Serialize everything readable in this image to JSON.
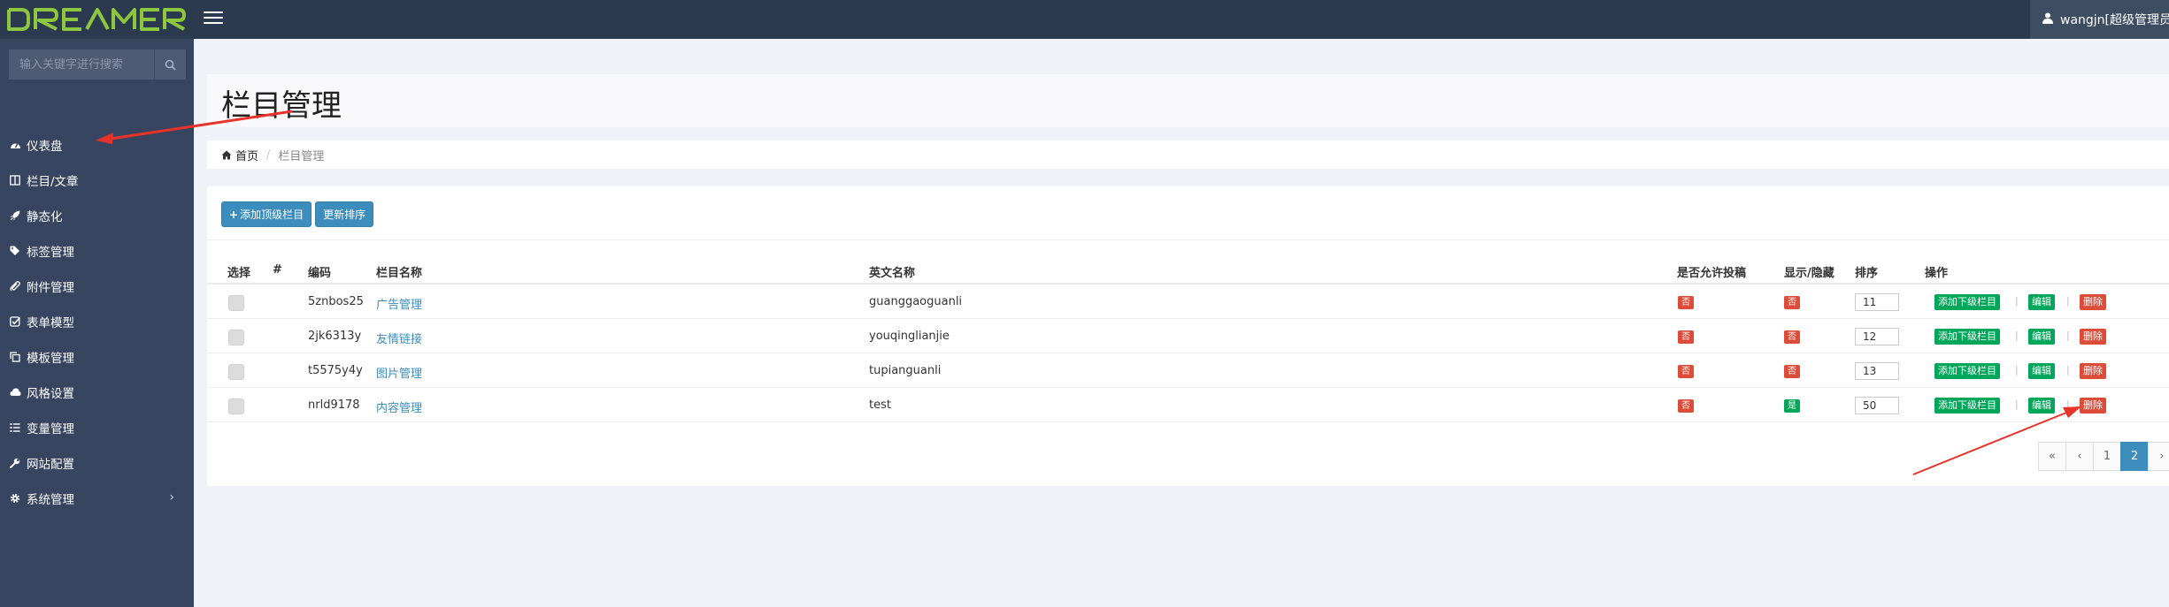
{
  "header": {
    "logo_text": "DREAMER",
    "user_label": "wangjn[超级管理员"
  },
  "sidebar": {
    "search_placeholder": "输入关键字进行搜索",
    "items": [
      {
        "label": "仪表盘",
        "icon": "dashboard-icon"
      },
      {
        "label": "栏目/文章",
        "icon": "columns-icon"
      },
      {
        "label": "静态化",
        "icon": "rocket-icon"
      },
      {
        "label": "标签管理",
        "icon": "tags-icon"
      },
      {
        "label": "附件管理",
        "icon": "paperclip-icon"
      },
      {
        "label": "表单模型",
        "icon": "check-square-icon"
      },
      {
        "label": "模板管理",
        "icon": "copy-icon"
      },
      {
        "label": "风格设置",
        "icon": "cloud-icon"
      },
      {
        "label": "变量管理",
        "icon": "list-icon"
      },
      {
        "label": "网站配置",
        "icon": "wrench-icon"
      },
      {
        "label": "系统管理",
        "icon": "cog-icon"
      }
    ]
  },
  "page": {
    "title": "栏目管理",
    "breadcrumb": {
      "home": "首页",
      "current": "栏目管理"
    }
  },
  "toolbar": {
    "add_top_label": "添加顶级栏目",
    "update_sort_label": "更新排序"
  },
  "table": {
    "headers": {
      "select": "选择",
      "index": "#",
      "code": "编码",
      "name": "栏目名称",
      "english": "英文名称",
      "allow_submit": "是否允许投稿",
      "visible": "显示/隐藏",
      "sort": "排序",
      "actions": "操作"
    },
    "rows": [
      {
        "code": "5znbos25",
        "name": "广告管理",
        "english": "guanggaoguanli",
        "allow_submit": "否",
        "visible": "否",
        "sort": "11"
      },
      {
        "code": "2jk6313y",
        "name": "友情链接",
        "english": "youqinglianjie",
        "allow_submit": "否",
        "visible": "否",
        "sort": "12"
      },
      {
        "code": "t5575y4y",
        "name": "图片管理",
        "english": "tupianguanli",
        "allow_submit": "否",
        "visible": "否",
        "sort": "13"
      },
      {
        "code": "nrld9178",
        "name": "内容管理",
        "english": "test",
        "allow_submit": "否",
        "visible": "是",
        "sort": "50"
      }
    ],
    "actions": {
      "add_child": "添加下级栏目",
      "edit": "编辑",
      "delete": "删除",
      "separator": "|"
    }
  },
  "pagination": {
    "first": "«",
    "prev": "‹",
    "pages": [
      "1",
      "2"
    ],
    "next": "›",
    "current": "2"
  },
  "colors": {
    "topbar": "#2b3a4e",
    "sidebar": "#384560",
    "logo": "#8dc63f",
    "primary": "#3c8dbc",
    "success": "#00a65a",
    "danger": "#dd4b39",
    "annotation_arrow": "#e8322a"
  }
}
